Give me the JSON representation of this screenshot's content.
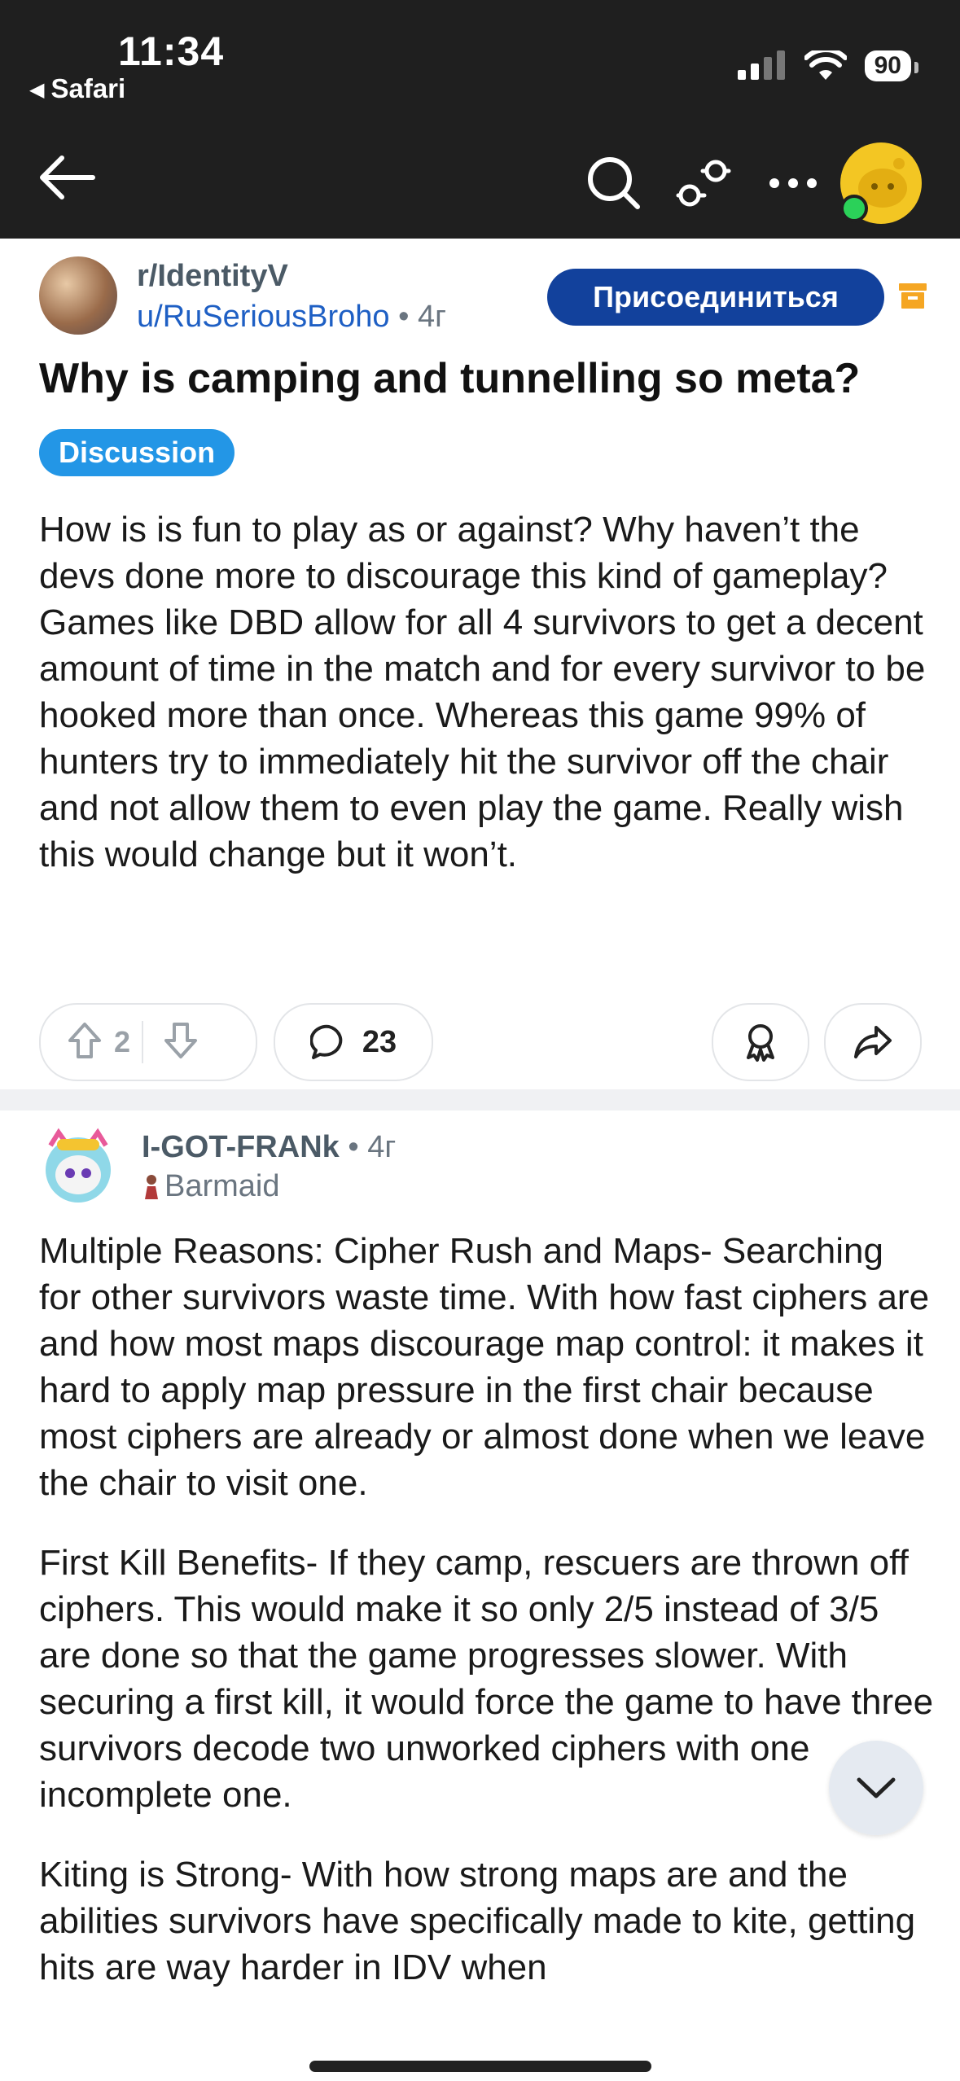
{
  "status_bar": {
    "time": "11:34",
    "back_app": "Safari",
    "battery": "90"
  },
  "post": {
    "subreddit": "r/IdentityV",
    "author": "u/RuSeriousBroho",
    "age": "• 4г",
    "join_label": "Присоединиться",
    "title": "Why is camping and tunnelling so meta?",
    "flair": "Discussion",
    "body": "How is is fun to play as or against? Why haven’t the devs done more to discourage this kind of gameplay? Games like DBD allow for all 4 survivors to get a decent amount of time in the match and for every survivor to be hooked more than once. Whereas this game 99% of hunters try to immediately hit the survivor off the chair and not allow them to even play the game. Really wish this would change but it won’t.",
    "upvotes": "2",
    "comments": "23"
  },
  "comment": {
    "author": "I-GOT-FRANk",
    "age": "• 4г",
    "flair": "Barmaid",
    "paragraphs": [
      "Multiple Reasons: Cipher Rush and Maps- Searching for other survivors waste time. With how fast ciphers are and how most maps discourage map control: it makes it hard to apply map pressure in the first chair because most ciphers are already or almost done when we leave the chair to visit one.",
      "First Kill Benefits- If they camp, rescuers are thrown off ciphers. This would make it so only 2/5 instead of 3/5 are done so that the game progresses slower. With securing a first kill, it would force the game to have three survivors decode two unworked ciphers with one incomplete one.",
      "Kiting is Strong- With how strong maps are and the abilities survivors have specifically made to kite, getting hits are way harder in IDV when"
    ]
  },
  "colors": {
    "join": "#12419c",
    "flair": "#2396e6",
    "link": "#1e5fc4",
    "archive": "#f5a623"
  }
}
